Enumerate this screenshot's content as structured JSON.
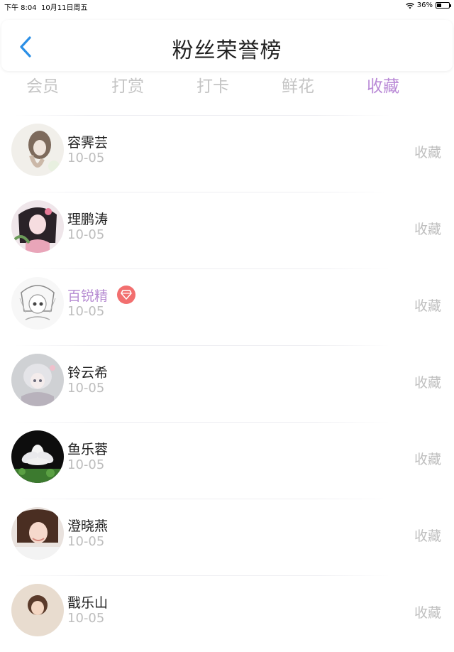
{
  "status_bar": {
    "time": "下午 8:04",
    "date": "10月11日周五",
    "battery": "36%"
  },
  "header": {
    "title": "粉丝荣誉榜"
  },
  "tabs": [
    {
      "label": "会员",
      "active": false
    },
    {
      "label": "打赏",
      "active": false
    },
    {
      "label": "打卡",
      "active": false
    },
    {
      "label": "鲜花",
      "active": false
    },
    {
      "label": "收藏",
      "active": true
    }
  ],
  "rows": [
    {
      "name": "容霁芸",
      "date": "10-05",
      "action": "收藏",
      "vip": false
    },
    {
      "name": "理鹏涛",
      "date": "10-05",
      "action": "收藏",
      "vip": false
    },
    {
      "name": "百锐精",
      "date": "10-05",
      "action": "收藏",
      "vip": true
    },
    {
      "name": "铃云希",
      "date": "10-05",
      "action": "收藏",
      "vip": false
    },
    {
      "name": "鱼乐蓉",
      "date": "10-05",
      "action": "收藏",
      "vip": false
    },
    {
      "name": "澄晓燕",
      "date": "10-05",
      "action": "收藏",
      "vip": false
    },
    {
      "name": "戬乐山",
      "date": "10-05",
      "action": "收藏",
      "vip": false
    }
  ],
  "colors": {
    "accent": "#b989d6",
    "back_arrow": "#2b8fe6",
    "badge": "#f26f6f"
  }
}
